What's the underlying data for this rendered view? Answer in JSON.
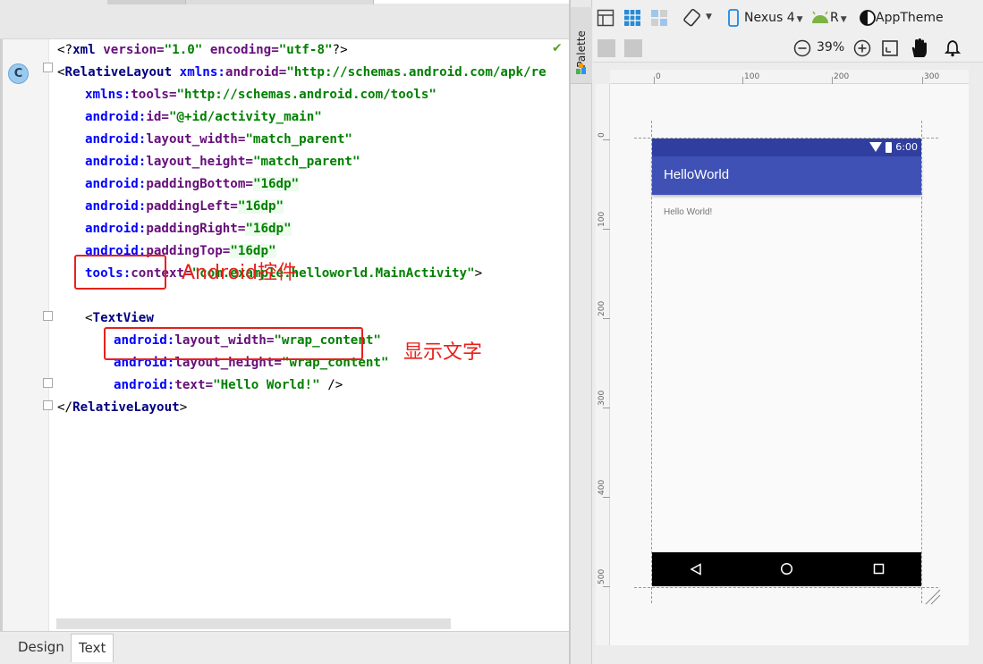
{
  "editor": {
    "lines": [
      [
        [
          "pn",
          "<?"
        ],
        [
          "tg",
          "xml "
        ],
        [
          "at",
          "version="
        ],
        [
          "av",
          "\"1.0\""
        ],
        [
          "pn",
          " "
        ],
        [
          "at",
          "encoding="
        ],
        [
          "av",
          "\"utf-8\""
        ],
        [
          "pn",
          "?>"
        ]
      ],
      [
        [
          "pn",
          "<"
        ],
        [
          "tg",
          "RelativeLayout "
        ],
        [
          "ns",
          "xmlns:"
        ],
        [
          "at",
          "android="
        ],
        [
          "av",
          "\"http://schemas.android.com/apk/re"
        ]
      ],
      [
        [
          "ns",
          "xmlns:"
        ],
        [
          "at",
          "tools="
        ],
        [
          "av",
          "\"http://schemas.android.com/tools\""
        ]
      ],
      [
        [
          "ns",
          "android:"
        ],
        [
          "at",
          "id="
        ],
        [
          "av",
          "\"@+id/activity_main\""
        ]
      ],
      [
        [
          "ns",
          "android:"
        ],
        [
          "at",
          "layout_width="
        ],
        [
          "av",
          "\"match_parent\""
        ]
      ],
      [
        [
          "ns",
          "android:"
        ],
        [
          "at",
          "layout_height="
        ],
        [
          "av",
          "\"match_parent\""
        ]
      ],
      [
        [
          "ns",
          "android:"
        ],
        [
          "at",
          "paddingBottom="
        ],
        [
          "av",
          "\"16dp\""
        ]
      ],
      [
        [
          "ns",
          "android:"
        ],
        [
          "at",
          "paddingLeft="
        ],
        [
          "av",
          "\"16dp\""
        ]
      ],
      [
        [
          "ns",
          "android:"
        ],
        [
          "at",
          "paddingRight="
        ],
        [
          "av",
          "\"16dp\""
        ]
      ],
      [
        [
          "ns",
          "android:"
        ],
        [
          "at",
          "paddingTop="
        ],
        [
          "av",
          "\"16dp\""
        ]
      ],
      [
        [
          "ns",
          "tools:"
        ],
        [
          "at",
          "context="
        ],
        [
          "av",
          "\"com.example.helloworld.MainActivity\""
        ],
        [
          "pn",
          ">"
        ]
      ],
      [],
      [
        [
          "pn",
          "<"
        ],
        [
          "tg",
          "TextView"
        ]
      ],
      [
        [
          "ns",
          "android:"
        ],
        [
          "at",
          "layout_width="
        ],
        [
          "av",
          "\"wrap_content\""
        ]
      ],
      [
        [
          "ns",
          "android:"
        ],
        [
          "at",
          "layout_height="
        ],
        [
          "av",
          "\"wrap_content\""
        ]
      ],
      [
        [
          "ns",
          "android:"
        ],
        [
          "at",
          "text="
        ],
        [
          "av",
          "\"Hello World!\""
        ],
        [
          "pn",
          " />"
        ]
      ],
      [
        [
          "pn",
          "</"
        ],
        [
          "tg",
          "RelativeLayout"
        ],
        [
          "pn",
          ">"
        ]
      ]
    ]
  },
  "annotations": {
    "control_label": "Android控件",
    "text_label": "显示文字"
  },
  "bottom_tabs": {
    "design": "Design",
    "text": "Text"
  },
  "palette": {
    "label": "Palette"
  },
  "toolbar": {
    "device": "Nexus 4",
    "api": "R",
    "theme": "AppTheme",
    "zoom": "39%"
  },
  "ruler": {
    "top": [
      "0",
      "100",
      "200",
      "300"
    ],
    "left": [
      "0",
      "100",
      "200",
      "300",
      "400",
      "500"
    ]
  },
  "preview": {
    "status_time": "6:00",
    "app_title": "HelloWorld",
    "hello_text": "Hello World!"
  },
  "colors": {
    "primary": "#3f51b5",
    "primary_dark": "#303f9f",
    "annotation_red": "#e8201a"
  }
}
